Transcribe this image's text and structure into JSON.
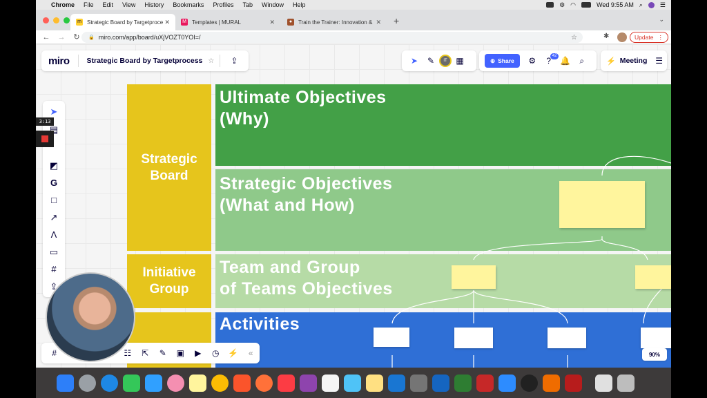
{
  "menubar": {
    "app": "Chrome",
    "items": [
      "File",
      "Edit",
      "View",
      "History",
      "Bookmarks",
      "Profiles",
      "Tab",
      "Window",
      "Help"
    ],
    "clock": "Wed 9:55 AM"
  },
  "tabs": [
    {
      "title": "Strategic Board by Targetproce",
      "favicon_color": "#ffd02f"
    },
    {
      "title": "Templates | MURAL",
      "favicon_color": "#e8175d"
    },
    {
      "title": "Train the Trainer: Innovation &",
      "favicon_color": "#a0522d"
    }
  ],
  "address": {
    "url": "miro.com/app/board/uXjVOZT0YOI=/",
    "update_label": "Update"
  },
  "miro": {
    "logo": "miro",
    "board_title": "Strategic Board by Targetprocess",
    "share_label": "Share",
    "notification_count": "42",
    "meeting_label": "Meeting",
    "user_initials": "IT",
    "zoom": "90%",
    "timer": "3:13"
  },
  "board": {
    "labels": [
      {
        "text": "Strategic\nBoard"
      },
      {
        "text": "Initiative\nGroup"
      }
    ],
    "rows": [
      {
        "title": "Ultimate Objectives\n(Why)",
        "color": "#43a047"
      },
      {
        "title": "Strategic Objectives\n(What and How)",
        "color": "#8fc98a"
      },
      {
        "title": "Team and Group\nof Teams Objectives",
        "color": "#b6dba6"
      },
      {
        "title": "Activities",
        "color": "#2f6fd6"
      }
    ]
  },
  "colors": {
    "label_yellow": "#e6c51c",
    "sticky": "#fff59d",
    "miro_blue": "#4262ff"
  }
}
